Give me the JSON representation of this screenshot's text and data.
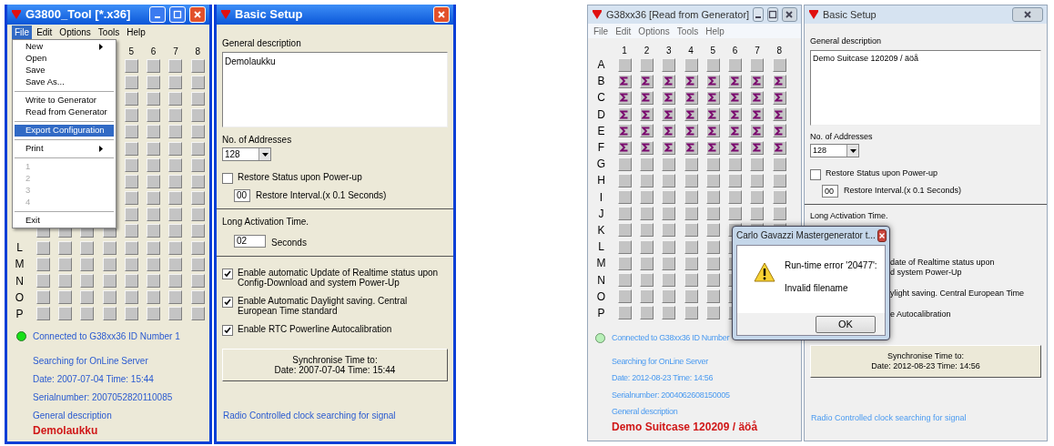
{
  "panels": [
    {
      "main": {
        "title": "G3800_Tool [*.x36]",
        "menu": [
          {
            "label": "File",
            "selected": true
          },
          {
            "label": "Edit",
            "selected": false
          },
          {
            "label": "Options",
            "selected": false
          },
          {
            "label": "Tools",
            "selected": false
          },
          {
            "label": "Help",
            "selected": false
          }
        ],
        "file_menu": [
          {
            "kind": "item",
            "label": "New",
            "submenu": true,
            "selected": false,
            "disabled": false
          },
          {
            "kind": "item",
            "label": "Open",
            "submenu": false,
            "selected": false,
            "disabled": false
          },
          {
            "kind": "item",
            "label": "Save",
            "submenu": false,
            "selected": false,
            "disabled": false
          },
          {
            "kind": "item",
            "label": "Save As...",
            "submenu": false,
            "selected": false,
            "disabled": false
          },
          {
            "kind": "separator"
          },
          {
            "kind": "item",
            "label": "Write to Generator",
            "submenu": false,
            "selected": false,
            "disabled": false
          },
          {
            "kind": "item",
            "label": "Read from Generator",
            "submenu": false,
            "selected": false,
            "disabled": false
          },
          {
            "kind": "separator"
          },
          {
            "kind": "item",
            "label": "Export Configuration",
            "submenu": false,
            "selected": true,
            "disabled": false
          },
          {
            "kind": "separator"
          },
          {
            "kind": "item",
            "label": "Print",
            "submenu": true,
            "selected": false,
            "disabled": false
          },
          {
            "kind": "separator"
          },
          {
            "kind": "item",
            "label": "1",
            "submenu": false,
            "selected": false,
            "disabled": true
          },
          {
            "kind": "item",
            "label": "2",
            "submenu": false,
            "selected": false,
            "disabled": true
          },
          {
            "kind": "item",
            "label": "3",
            "submenu": false,
            "selected": false,
            "disabled": true
          },
          {
            "kind": "item",
            "label": "4",
            "submenu": false,
            "selected": false,
            "disabled": true
          },
          {
            "kind": "separator"
          },
          {
            "kind": "item",
            "label": "Exit",
            "submenu": false,
            "selected": false,
            "disabled": false
          }
        ],
        "column_headers": [
          "5",
          "6",
          "7",
          "8"
        ],
        "rows": [
          {
            "kind": "plain"
          },
          {
            "kind": "plain"
          },
          {
            "kind": "plain"
          },
          {
            "kind": "plain"
          },
          {
            "kind": "plain"
          },
          {
            "kind": "plain"
          },
          {
            "kind": "plain"
          },
          {
            "kind": "plain"
          },
          {
            "kind": "plain"
          },
          {
            "kind": "plain"
          },
          {
            "kind": "plain"
          },
          {
            "label": "L",
            "kind": "plain"
          },
          {
            "label": "M",
            "kind": "plain"
          },
          {
            "label": "N",
            "kind": "plain"
          },
          {
            "label": "O",
            "kind": "plain"
          },
          {
            "label": "P",
            "kind": "plain"
          }
        ],
        "status": {
          "connected": true,
          "connection": "Connected to  G38xx36 ID Number 1",
          "server": "Searching for OnLine Server",
          "datetime": "Date: 2007-07-04  Time: 15:44",
          "serial": "Serialnumber: 2007052820110085",
          "description_label": "General description",
          "description": "Demolaukku"
        }
      },
      "setup": {
        "title": "Basic Setup",
        "items": [
          {
            "kind": "label",
            "text": "General description"
          },
          {
            "kind": "textarea",
            "value": "Demolaukku"
          },
          {
            "kind": "label",
            "text": "No. of Addresses"
          },
          {
            "kind": "select",
            "value": "128"
          },
          {
            "kind": "checkbox",
            "label": "Restore Status upon Power-up",
            "checked": false
          },
          {
            "kind": "number",
            "value": "00",
            "label": "Restore Interval.(x 0.1  Seconds)"
          },
          {
            "kind": "rule"
          },
          {
            "kind": "label",
            "text": "Long Activation Time."
          },
          {
            "kind": "number-wide",
            "value": "02",
            "label": "Seconds"
          },
          {
            "kind": "rule"
          },
          {
            "kind": "checkbox",
            "label": "Enable automatic Update of Realtime status upon Config-Download and system Power-Up",
            "checked": true
          },
          {
            "kind": "checkbox",
            "label": "Enable Automatic Daylight saving. Central European Time standard",
            "checked": true
          },
          {
            "kind": "checkbox",
            "label": "Enable RTC Powerline Autocalibration",
            "checked": true
          },
          {
            "kind": "button",
            "lines": [
              "Synchronise Time to:",
              "Date: 2007-07-04  Time: 15:44"
            ]
          },
          {
            "kind": "note",
            "text": "Radio Controlled clock searching for signal"
          }
        ]
      }
    },
    {
      "main": {
        "title": "G38xx36 [Read from Generator]",
        "menu": [
          {
            "label": "File",
            "selected": false
          },
          {
            "label": "Edit",
            "selected": false
          },
          {
            "label": "Options",
            "selected": false
          },
          {
            "label": "Tools",
            "selected": false
          },
          {
            "label": "Help",
            "selected": false
          }
        ],
        "column_headers": [
          "1",
          "2",
          "3",
          "4",
          "5",
          "6",
          "7",
          "8"
        ],
        "rows": [
          {
            "label": "A",
            "kind": "plain"
          },
          {
            "label": "B",
            "kind": "sigma"
          },
          {
            "label": "C",
            "kind": "sigma"
          },
          {
            "label": "D",
            "kind": "sigma"
          },
          {
            "label": "E",
            "kind": "sigma"
          },
          {
            "label": "F",
            "kind": "sigma"
          },
          {
            "label": "G",
            "kind": "plain"
          },
          {
            "label": "H",
            "kind": "plain"
          },
          {
            "label": "I",
            "kind": "plain"
          },
          {
            "label": "J",
            "kind": "plain"
          },
          {
            "label": "K",
            "kind": "plain"
          },
          {
            "label": "L",
            "kind": "plain"
          },
          {
            "label": "M",
            "kind": "plain"
          },
          {
            "label": "N",
            "kind": "plain"
          },
          {
            "label": "O",
            "kind": "plain"
          },
          {
            "label": "P",
            "kind": "plain"
          }
        ],
        "status": {
          "connected": true,
          "connection": "Connected to  G38xx36 ID Number",
          "server": "Searching for OnLine Server",
          "datetime": "Date: 2012-08-23  Time: 14:56",
          "serial": "Serialnumber: 2004062608150005",
          "description_label": "General description",
          "description": "Demo Suitcase 120209 / äöå"
        }
      },
      "setup": {
        "title": "Basic Setup",
        "items": [
          {
            "kind": "label",
            "text": "General description"
          },
          {
            "kind": "textarea",
            "value": "Demo Suitcase 120209 / äöå"
          },
          {
            "kind": "label",
            "text": "No. of Addresses"
          },
          {
            "kind": "select",
            "value": "128"
          },
          {
            "kind": "checkbox",
            "label": "Restore Status upon Power-up",
            "checked": false
          },
          {
            "kind": "number",
            "value": "00",
            "label": "Restore Interval.(x 0.1  Seconds)"
          },
          {
            "kind": "rule"
          },
          {
            "kind": "label",
            "text": "Long Activation Time."
          },
          {
            "kind": "fragment",
            "lines": [
              "date of Realtime status upon",
              "d system Power-Up"
            ]
          },
          {
            "kind": "fragment",
            "lines": [
              "ylight saving. Central European Time"
            ]
          },
          {
            "kind": "fragment",
            "lines": [
              "e Autocalibration"
            ]
          },
          {
            "kind": "button",
            "lines": [
              "Synchronise Time to:",
              "Date: 2012-08-23  Time: 14:56"
            ]
          },
          {
            "kind": "note",
            "text": "Radio Controlled clock searching for signal"
          }
        ]
      },
      "dialog": {
        "title": "Carlo Gavazzi Mastergenerator t...",
        "message": "Run-time error '20477':",
        "detail": "Invalid filename",
        "button": "OK"
      }
    }
  ]
}
